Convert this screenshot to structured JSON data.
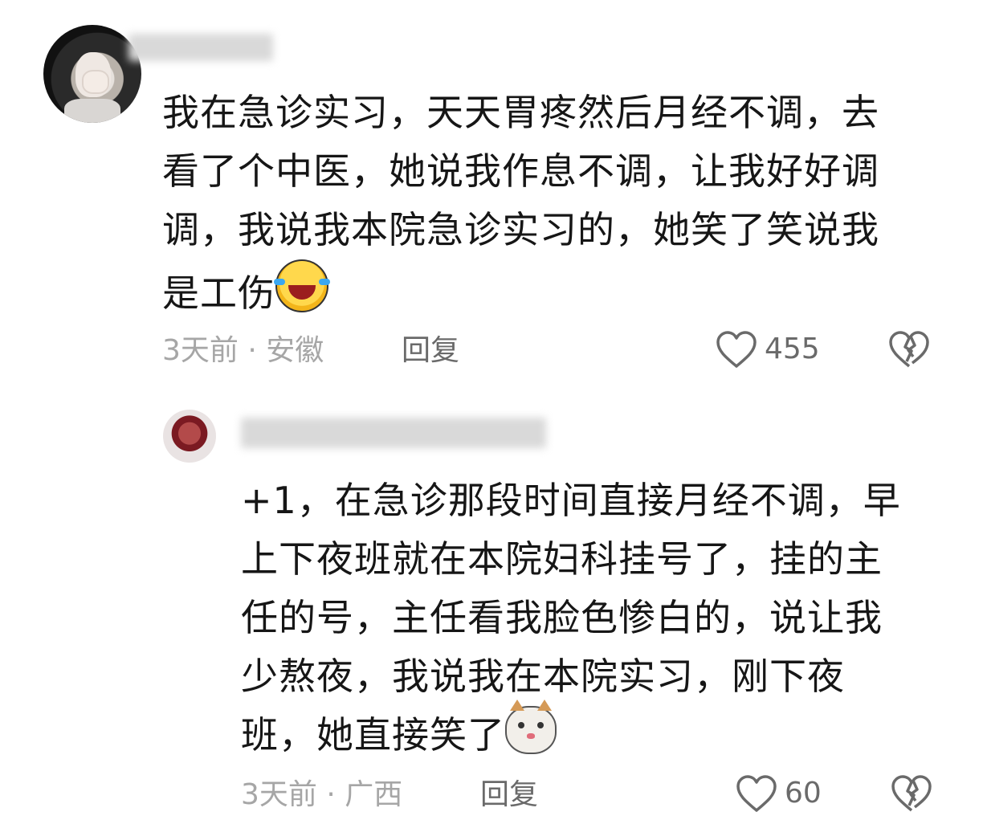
{
  "comments": [
    {
      "text": "我在急诊实习，天天胃疼然后月经不调，去\n看了个中医，她说我作息不调，让我好好调\n调，我说我本院急诊实习的，她笑了笑说我\n是工伤",
      "emoji": "laugh-cry-emoji",
      "meta": "3天前 · 安徽",
      "reply_label": "回复",
      "likes": "455"
    },
    {
      "text": "+1，在急诊那段时间直接月经不调，早\n上下夜班就在本院妇科挂号了，挂的主\n任的号，主任看我脸色惨白的，说让我\n少熬夜，我说我在本院实习，刚下夜\n班，她直接笑了",
      "emoji": "cat-emoji",
      "meta": "3天前 · 广西",
      "reply_label": "回复",
      "likes": "60"
    }
  ],
  "colors": {
    "text": "#161616",
    "meta": "#a6a6a6",
    "icon": "#6a6a6a",
    "background": "#ffffff"
  }
}
